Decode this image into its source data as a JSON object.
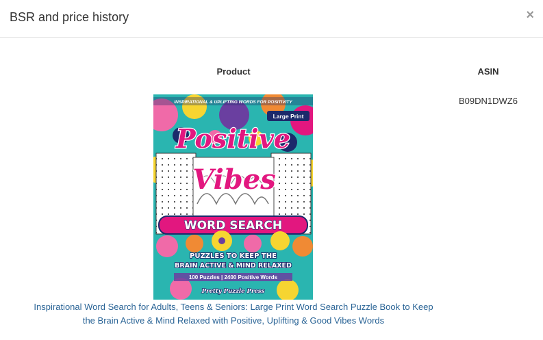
{
  "modal": {
    "title": "BSR and price history",
    "close_label": "×"
  },
  "table": {
    "headers": {
      "product": "Product",
      "asin": "ASIN"
    },
    "row": {
      "asin": "B09DN1DWZ6",
      "product_title": "Inspirational Word Search for Adults, Teens & Seniors: Large Print Word Search Puzzle Book to Keep the Brain Active & Mind Relaxed with Positive, Uplifting & Good Vibes Words"
    }
  },
  "cover": {
    "top_banner": "INSPIRATIONAL & UPLIFTING WORDS FOR POSITIVITY",
    "badge": "Large Print",
    "title_line1": "Positive",
    "title_line2": "Vibes",
    "subtitle": "WORD SEARCH",
    "tagline_line1": "PUZZLES TO KEEP THE",
    "tagline_line2": "BRAIN ACTIVE & MIND RELAXED",
    "stats": "100 Puzzles | 2400 Positive Words",
    "publisher": "Pretty Puzzle Press",
    "colors": {
      "magenta": "#e2177f",
      "pink": "#f06aa8",
      "purple": "#6a3fa0",
      "navy": "#1c2a6b",
      "teal": "#2ab5b0",
      "yellow": "#f6d531",
      "orange": "#f08a34"
    }
  }
}
